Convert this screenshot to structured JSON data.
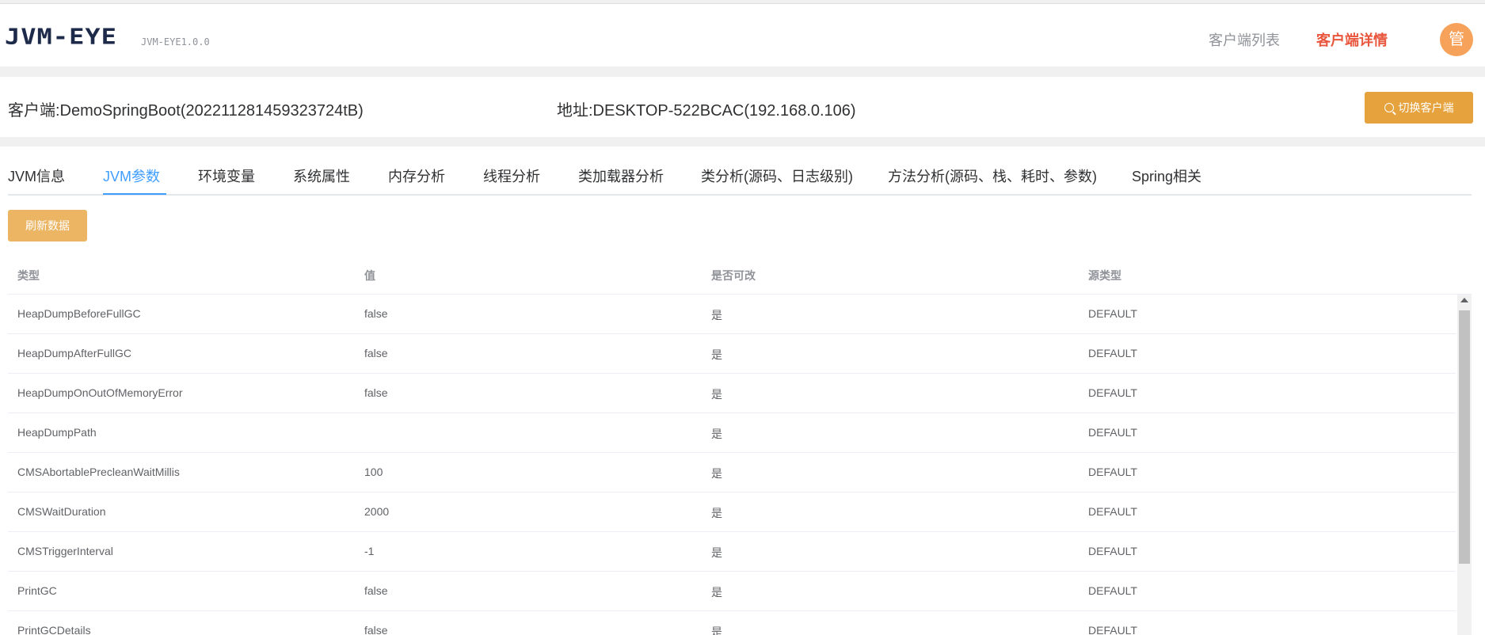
{
  "header": {
    "logo": "JVM-EYE",
    "version": "JVM-EYE1.0.0",
    "nav": [
      "客户端列表",
      "客户端详情"
    ],
    "avatar_char": "管"
  },
  "client": {
    "client_label": "客户端:DemoSpringBoot(202211281459323724tB)",
    "address_label": "地址:DESKTOP-522BCAC(192.168.0.106)",
    "switch_button": "切换客户端"
  },
  "tabs": [
    "JVM信息",
    "JVM参数",
    "环境变量",
    "系统属性",
    "内存分析",
    "线程分析",
    "类加载器分析",
    "类分析(源码、日志级别)",
    "方法分析(源码、栈、耗时、参数)",
    "Spring相关"
  ],
  "active_tab": "JVM参数",
  "refresh_button": "刷新数据",
  "table": {
    "columns": [
      "类型",
      "值",
      "是否可改",
      "源类型"
    ],
    "rows": [
      [
        "HeapDumpBeforeFullGC",
        "false",
        "是",
        "DEFAULT"
      ],
      [
        "HeapDumpAfterFullGC",
        "false",
        "是",
        "DEFAULT"
      ],
      [
        "HeapDumpOnOutOfMemoryError",
        "false",
        "是",
        "DEFAULT"
      ],
      [
        "HeapDumpPath",
        "",
        "是",
        "DEFAULT"
      ],
      [
        "CMSAbortablePrecleanWaitMillis",
        "100",
        "是",
        "DEFAULT"
      ],
      [
        "CMSWaitDuration",
        "2000",
        "是",
        "DEFAULT"
      ],
      [
        "CMSTriggerInterval",
        "-1",
        "是",
        "DEFAULT"
      ],
      [
        "PrintGC",
        "false",
        "是",
        "DEFAULT"
      ],
      [
        "PrintGCDetails",
        "false",
        "是",
        "DEFAULT"
      ]
    ]
  },
  "colors": {
    "primary": "#409eff",
    "warning": "#e6a23c",
    "active_nav": "#e8573d",
    "avatar": "#f7a25b"
  }
}
